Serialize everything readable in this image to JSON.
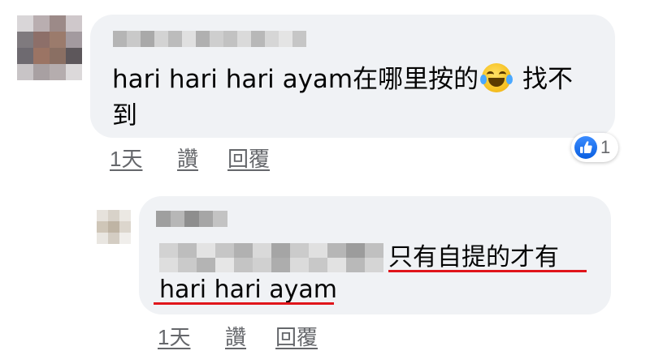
{
  "comment": {
    "text_line1": "hari hari hari ayam在哪里按的",
    "text_line1_tail": "找不",
    "text_line2": "到",
    "emoji": "face-with-tears-of-joy",
    "actions": {
      "time": "1天",
      "like": "讚",
      "reply": "回覆"
    },
    "reactions": {
      "icon": "like-icon",
      "count": "1"
    }
  },
  "reply": {
    "text_part1": "只有自提的才有",
    "text_part2": "hari hari ayam",
    "actions": {
      "time": "1天",
      "like": "讚",
      "reply": "回覆"
    }
  },
  "colors": {
    "bubble": "#f0f2f5",
    "action_text": "#65676b",
    "highlight_underline": "#e0151b",
    "like_blue": "#1877f2"
  }
}
